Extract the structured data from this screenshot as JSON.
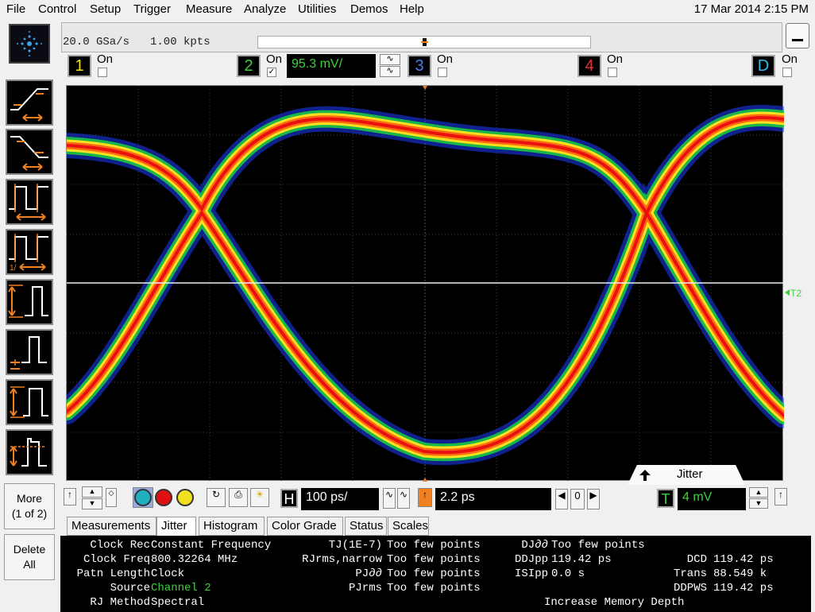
{
  "menu": [
    "File",
    "Control",
    "Setup",
    "Trigger",
    "Measure",
    "Analyze",
    "Utilities",
    "Demos",
    "Help"
  ],
  "datetime": "17 Mar 2014  2:15 PM",
  "acquisition": {
    "sample_rate": "20.0 GSa/s",
    "memory_depth": "1.00 kpts"
  },
  "channels": [
    {
      "num": "1",
      "label": "On",
      "checked": false,
      "color": "#f0e020"
    },
    {
      "num": "2",
      "label": "On",
      "checked": true,
      "color": "#3cd23c",
      "scale": "95.3 mV/"
    },
    {
      "num": "3",
      "label": "On",
      "checked": false,
      "color": "#4a7cf0"
    },
    {
      "num": "4",
      "label": "On",
      "checked": false,
      "color": "#e8303a"
    },
    {
      "num": "D",
      "label": "On",
      "checked": false,
      "color": "#30b8e8"
    }
  ],
  "sidebar": {
    "more_label": "More\n(1 of 2)",
    "delete_label": "Delete\nAll"
  },
  "timebase": {
    "scale_tag": "H",
    "scale": "100 ps/",
    "delay": "2.2 ps",
    "delay_ref": "0"
  },
  "trigger": {
    "tag": "T",
    "level": "4 mV"
  },
  "jitter_tab": "Jitter",
  "tabs": [
    "Measurements",
    "Jitter",
    "Histogram",
    "Color Grade",
    "Status",
    "Scales"
  ],
  "active_tab": "Jitter",
  "jitter": {
    "left": [
      {
        "label": "Clock Rec",
        "value": "Constant Frequency"
      },
      {
        "label": "Clock Freq",
        "value": "800.32264 MHz"
      },
      {
        "label": "Patn Length",
        "value": "Clock"
      },
      {
        "label": "Source",
        "value": "Channel 2"
      },
      {
        "label": "RJ Method",
        "value": "Spectral"
      }
    ],
    "mid": [
      {
        "label": "TJ(1E-7)",
        "value": "Too few points"
      },
      {
        "label": "RJrms,narrow",
        "value": "Too few points"
      },
      {
        "label": "PJ∂∂",
        "value": "Too few points"
      },
      {
        "label": "PJrms",
        "value": "Too few points"
      }
    ],
    "right": [
      {
        "label": "DJ∂∂",
        "value": "Too few points"
      },
      {
        "label": "DDJpp",
        "value": "119.42 ps"
      },
      {
        "label": "ISIpp",
        "value": "0.0 s"
      }
    ],
    "far_right": [
      {
        "label": "DCD",
        "value": "119.42 ps"
      },
      {
        "label": "Trans",
        "value": "88.549 k"
      },
      {
        "label": "DDPWS",
        "value": "119.42 ps"
      }
    ],
    "message": "Increase Memory Depth"
  }
}
